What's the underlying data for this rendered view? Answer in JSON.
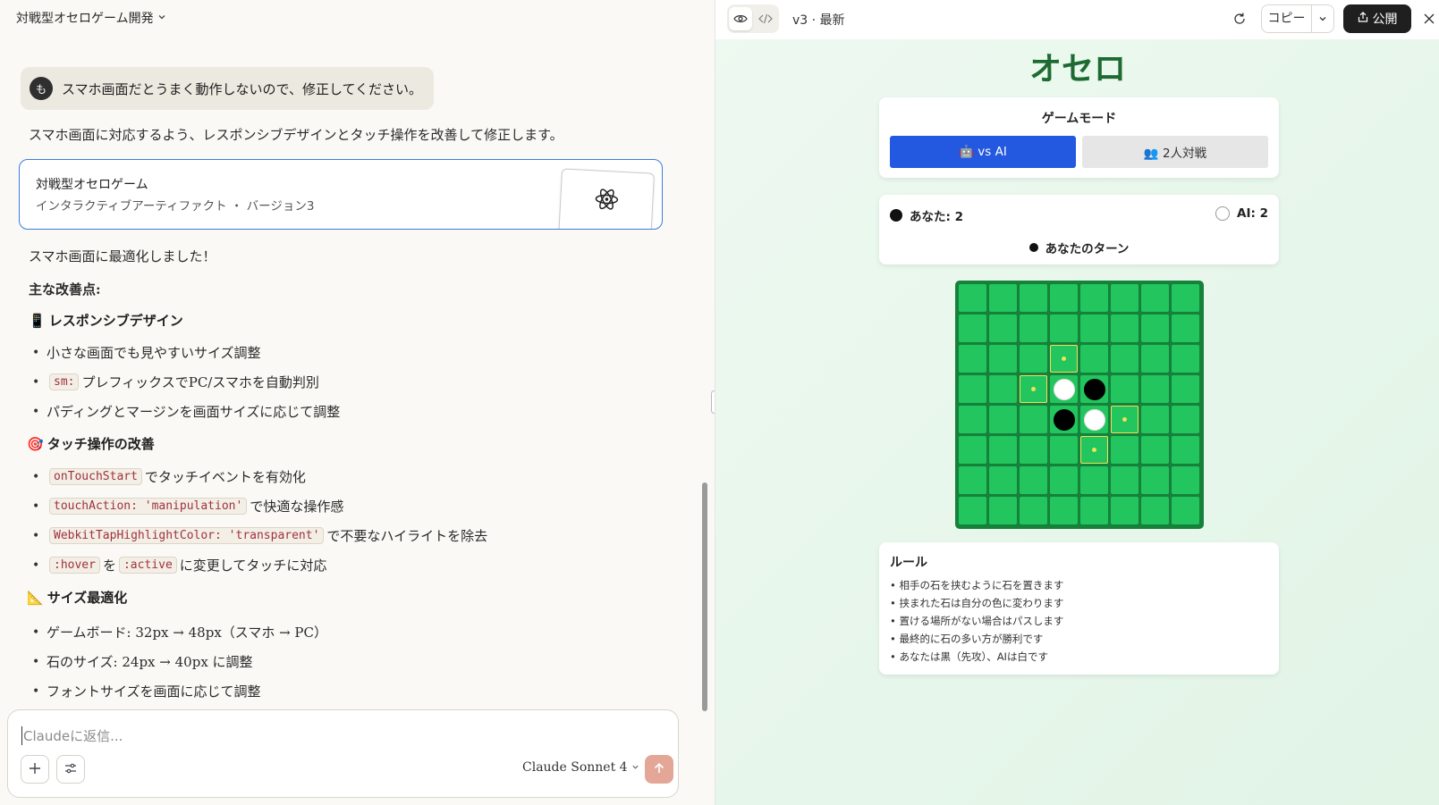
{
  "conversation": {
    "title": "対戦型オセロゲーム開発",
    "user_avatar": "も",
    "user_message": "スマホ画面だとうまく動作しないので、修正してください。",
    "reply_intro": "スマホ画面に対応するよう、レスポンシブデザインとタッチ操作を改善して修正します。",
    "artifact": {
      "title": "対戦型オセロゲーム",
      "subtitle": "インタラクティブアーティファクト ・ バージョン3"
    },
    "reply_summary": "スマホ画面に最適化しました！",
    "improvements_heading": "主な改善点:",
    "sections": [
      {
        "icon": "📱",
        "heading": "レスポンシブデザイン",
        "items": [
          {
            "text": "小さな画面でも見やすいサイズ調整"
          },
          {
            "code": "sm:",
            "text": "プレフィックスでPC/スマホを自動判別"
          },
          {
            "text": "パディングとマージンを画面サイズに応じて調整"
          }
        ]
      },
      {
        "icon": "🎯",
        "heading": "タッチ操作の改善",
        "items": [
          {
            "code": "onTouchStart",
            "text": "でタッチイベントを有効化"
          },
          {
            "code": "touchAction: 'manipulation'",
            "text": "で快適な操作感"
          },
          {
            "code": "WebkitTapHighlightColor: 'transparent'",
            "text": "で不要なハイライトを除去"
          },
          {
            "code": ":hover",
            "mid": "を",
            "code2": ":active",
            "text": "に変更してタッチに対応"
          }
        ]
      },
      {
        "icon": "📐",
        "heading": "サイズ最適化",
        "items": [
          {
            "text": "ゲームボード: 32px → 48px（スマホ → PC）"
          },
          {
            "text": "石のサイズ: 24px → 40px に調整"
          },
          {
            "text": "フォントサイズを画面に応じて調整"
          }
        ]
      }
    ],
    "composer": {
      "placeholder": "Claudeに返信...",
      "model": "Claude Sonnet 4"
    }
  },
  "artifact_panel": {
    "version_label": "v3 · 最新",
    "copy_label": "コピー",
    "publish_label": "公開",
    "game": {
      "title": "オセロ",
      "mode_heading": "ゲームモード",
      "mode_ai": "🤖 vs AI",
      "mode_pvp": "👥 2人対戦",
      "selected_mode": "vs AI",
      "score_you": "あなた: 2",
      "score_ai": "AI: 2",
      "turn": "あなたのターン",
      "board": [
        "........",
        "........",
        "...v....",
        "..vWB...",
        "...BWv..",
        "....v...",
        "........",
        "........"
      ],
      "rules_heading": "ルール",
      "rules": [
        "• 相手の石を挟むように石を置きます",
        "• 挟まれた石は自分の色に変わります",
        "• 置ける場所がない場合はパスします",
        "• 最終的に石の多い方が勝利です",
        "• あなたは黒（先攻）、AIは白です"
      ]
    }
  },
  "colors": {
    "accent_blue": "#2358e0",
    "board_green": "#16813a",
    "cell_green": "#22c55e",
    "title_green": "#1e6b32",
    "send_button": "#e4a696"
  }
}
